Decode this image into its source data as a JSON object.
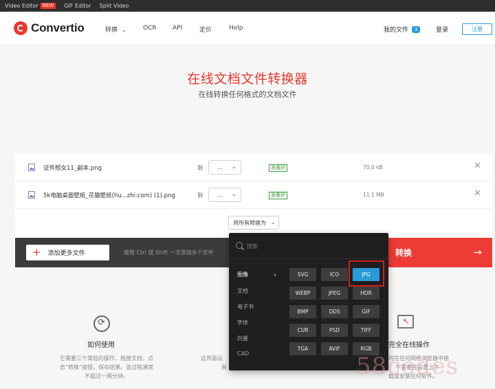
{
  "topbar": {
    "items": [
      "Video Editor",
      "GIF Editor",
      "Split Video"
    ],
    "new_badge": "NEW"
  },
  "nav": {
    "logo": "Convertio",
    "links": [
      "转换",
      "OCR",
      "API",
      "定价",
      "Help"
    ],
    "my_files": "我的文件",
    "files_count": "3",
    "login": "登录",
    "register": "注册"
  },
  "hero": {
    "title": "在线文档文件转换器",
    "subtitle": "在线转换任何格式的文档文件"
  },
  "files": [
    {
      "name": "证件照女11_副本.png",
      "to": "到",
      "format": "...",
      "status": "准备好",
      "size": "70.0 kB"
    },
    {
      "name": "5k电脑桌面壁纸_花猫壁纸(hu...zhi.com) (1).png",
      "to": "到",
      "format": "...",
      "status": "准备好",
      "size": "11.1 MB"
    }
  ],
  "convert_all_label": "将所有转换为",
  "action_bar": {
    "add_more": "添加更多文件",
    "hint": "使用 Ctrl 或 Shift 一次添加多个文件",
    "convert": "转换"
  },
  "dropdown": {
    "search_placeholder": "搜索",
    "categories": [
      "图像",
      "文档",
      "电子书",
      "字体",
      "向量",
      "CAD"
    ],
    "active_category": "图像",
    "formats": [
      "SVG",
      "ICO",
      "JPG",
      "WEBP",
      "JPEG",
      "HDR",
      "BMP",
      "DDS",
      "GIF",
      "CUR",
      "PSD",
      "TIFF",
      "TGA",
      "AVIF",
      "RGB"
    ],
    "selected_format": "JPG"
  },
  "info": {
    "how_title": "如何使用",
    "how_text": [
      "它需要三个简短的操作，拖放文档，点",
      "击“转换”按钮，保存结果。该过程通常",
      "不超过一两分钟。"
    ],
    "mid_text": [
      "这界面设",
      "易"
    ],
    "secure_title": "完全在线操作",
    "secure_text": [
      "可在任何网络浏览器中使",
      "不需要在设置上下",
      "载或安装任何软件。"
    ]
  },
  "watermark": "58codes",
  "colors": {
    "brand_red": "#e8382c",
    "accent_blue": "#2a9ad8",
    "dark_bar": "#3b3b3b",
    "dropdown_bg": "#1f1f1f"
  },
  "icons": {
    "logo": "convertio-logo-icon",
    "file": "image-file-icon",
    "close": "close-icon",
    "plus": "plus-icon",
    "arrow": "arrow-right-icon",
    "search": "search-icon",
    "chevron": "chevron-down-icon"
  }
}
